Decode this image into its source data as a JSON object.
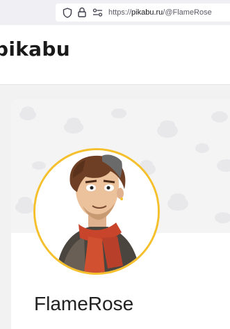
{
  "browser": {
    "url_scheme": "https://",
    "url_host": "pikabu.ru",
    "url_path": "/@FlameRose",
    "icons": [
      "shield-icon",
      "lock-icon",
      "permissions-icon"
    ]
  },
  "header": {
    "logo_text": "pikabu"
  },
  "profile": {
    "username": "FlameRose",
    "avatar_ring_color": "#f5c02c"
  }
}
